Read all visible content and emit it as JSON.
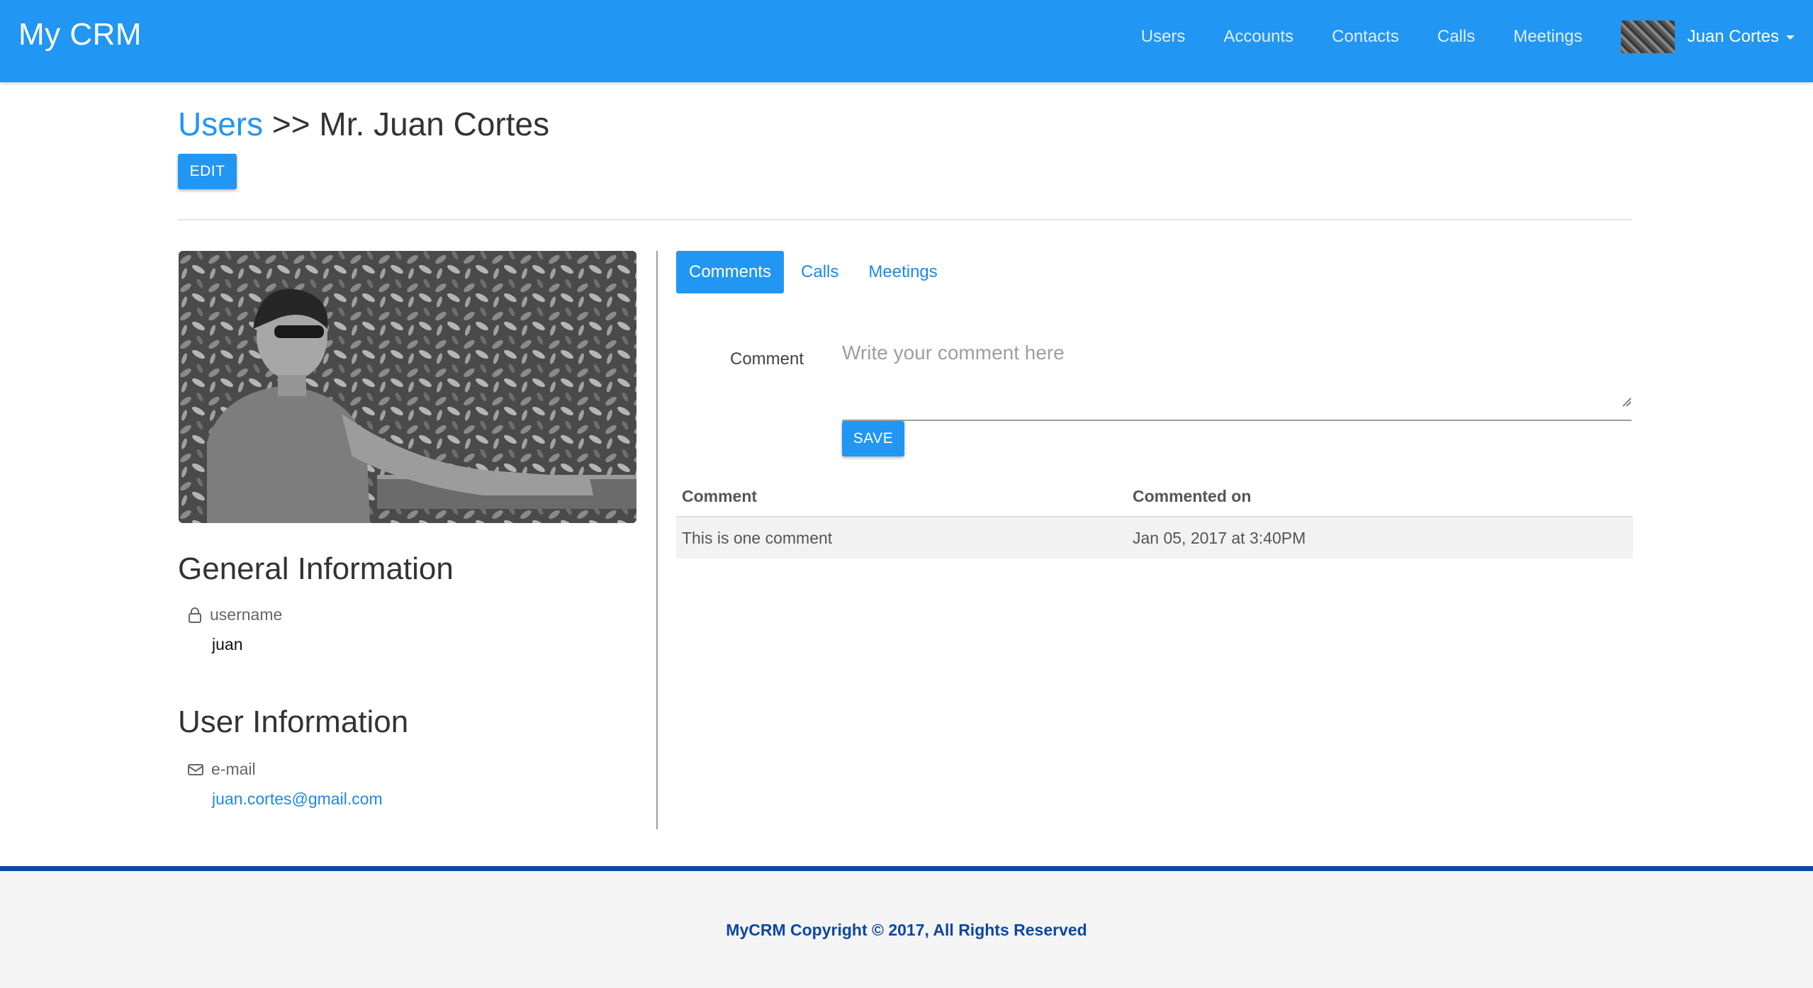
{
  "app": {
    "brand": "My CRM"
  },
  "nav": {
    "links": [
      "Users",
      "Accounts",
      "Contacts",
      "Calls",
      "Meetings"
    ],
    "user_name": "Juan Cortes"
  },
  "page": {
    "breadcrumb_link": "Users",
    "separator": ">>",
    "title": "Mr. Juan Cortes",
    "edit_label": "EDIT"
  },
  "profile": {
    "general_title": "General Information",
    "username_label": "username",
    "username_value": "juan",
    "user_info_title": "User Information",
    "email_label": "e-mail",
    "email_value": "juan.cortes@gmail.com"
  },
  "tabs": {
    "items": [
      "Comments",
      "Calls",
      "Meetings"
    ],
    "active": "Comments"
  },
  "comment_form": {
    "label": "Comment",
    "placeholder": "Write your comment here",
    "save_label": "SAVE"
  },
  "comments_table": {
    "headers": [
      "Comment",
      "Commented on"
    ],
    "rows": [
      [
        "This is one comment",
        "Jan 05, 2017 at 3:40PM"
      ]
    ]
  },
  "footer": {
    "text": "MyCRM Copyright © 2017, All Rights Reserved"
  },
  "colors": {
    "primary": "#2196f3",
    "footer_accent": "#0d47a1",
    "link": "#1e88e5"
  }
}
